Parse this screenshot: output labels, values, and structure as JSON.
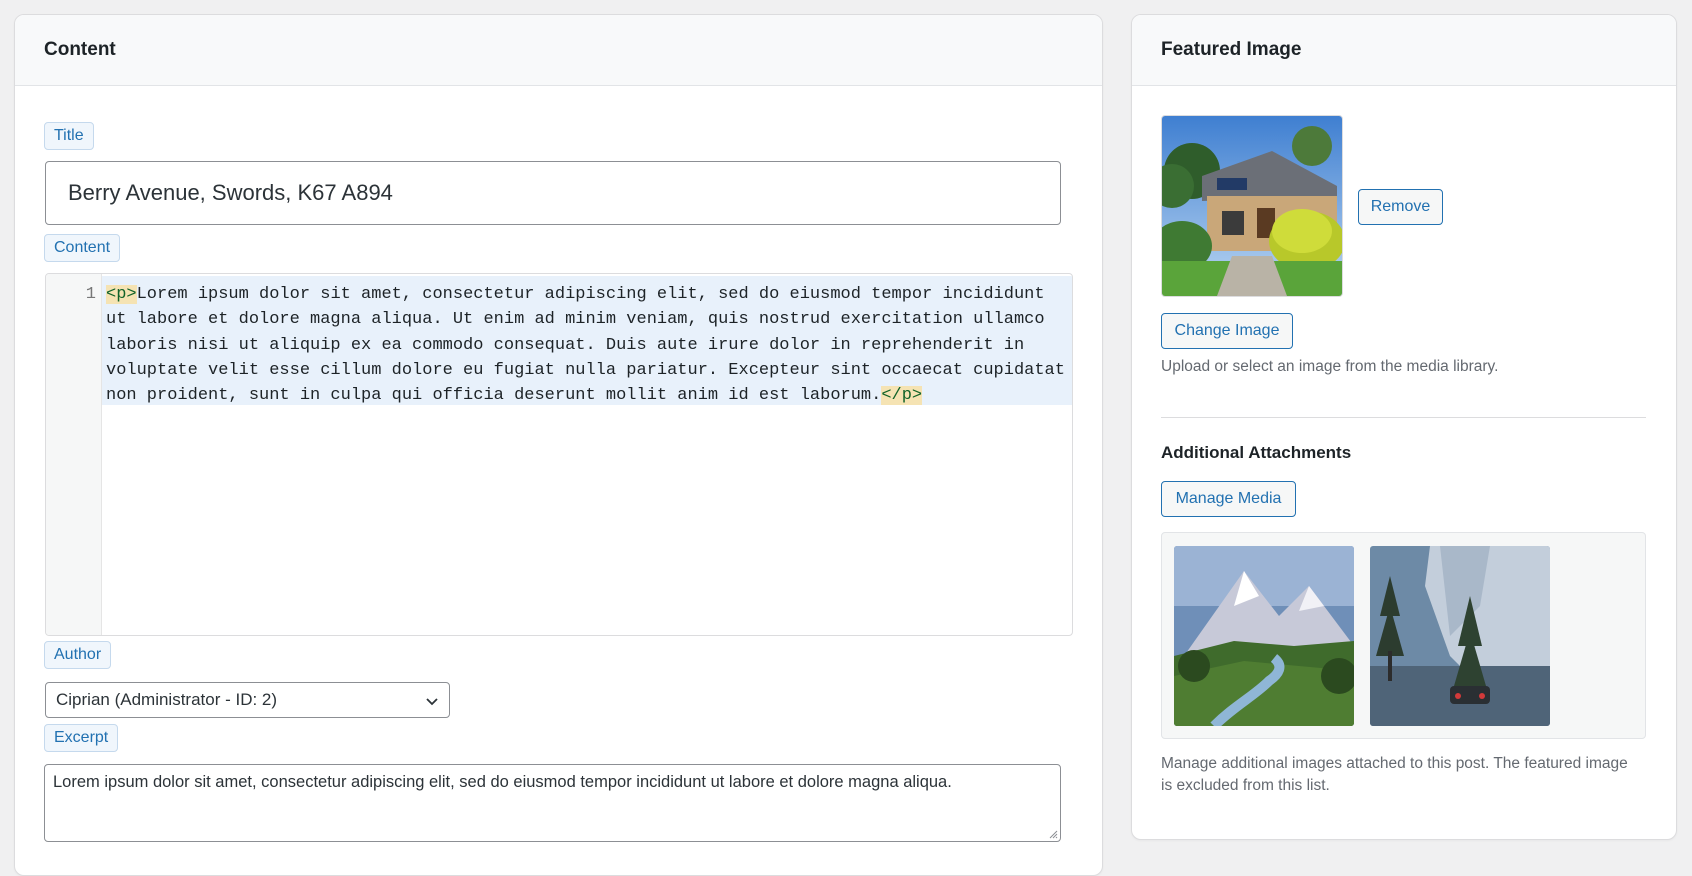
{
  "content_panel": {
    "heading": "Content",
    "title_label": "Title",
    "title_value": "Berry Avenue, Swords, K67 A894",
    "content_label": "Content",
    "editor": {
      "line_number": "1",
      "open_tag": "<p>",
      "text": "Lorem ipsum dolor sit amet, consectetur adipiscing elit, sed do eiusmod tempor incididunt ut labore et dolore magna aliqua. Ut enim ad minim veniam, quis nostrud exercitation ullamco laboris nisi ut aliquip ex ea commodo consequat. Duis aute irure dolor in reprehenderit in voluptate velit esse cillum dolore eu fugiat nulla pariatur. Excepteur sint occaecat cupidatat non proident, sunt in culpa qui officia deserunt mollit anim id est laborum.",
      "close_tag": "</p>"
    },
    "author_label": "Author",
    "author_selected": "Ciprian (Administrator - ID: 2)",
    "excerpt_label": "Excerpt",
    "excerpt_value": "Lorem ipsum dolor sit amet, consectetur adipiscing elit, sed do eiusmod tempor incididunt ut labore et dolore magna aliqua."
  },
  "featured_panel": {
    "heading": "Featured Image",
    "remove_label": "Remove",
    "change_label": "Change Image",
    "help_text": "Upload or select an image from the media library.",
    "attachments_heading": "Additional Attachments",
    "manage_label": "Manage Media",
    "attachments_help": "Manage additional images attached to this post. The featured image is excluded from this list."
  },
  "colors": {
    "accent": "#2271b1",
    "border": "#dcdcde",
    "page_bg": "#f0f0f1"
  }
}
